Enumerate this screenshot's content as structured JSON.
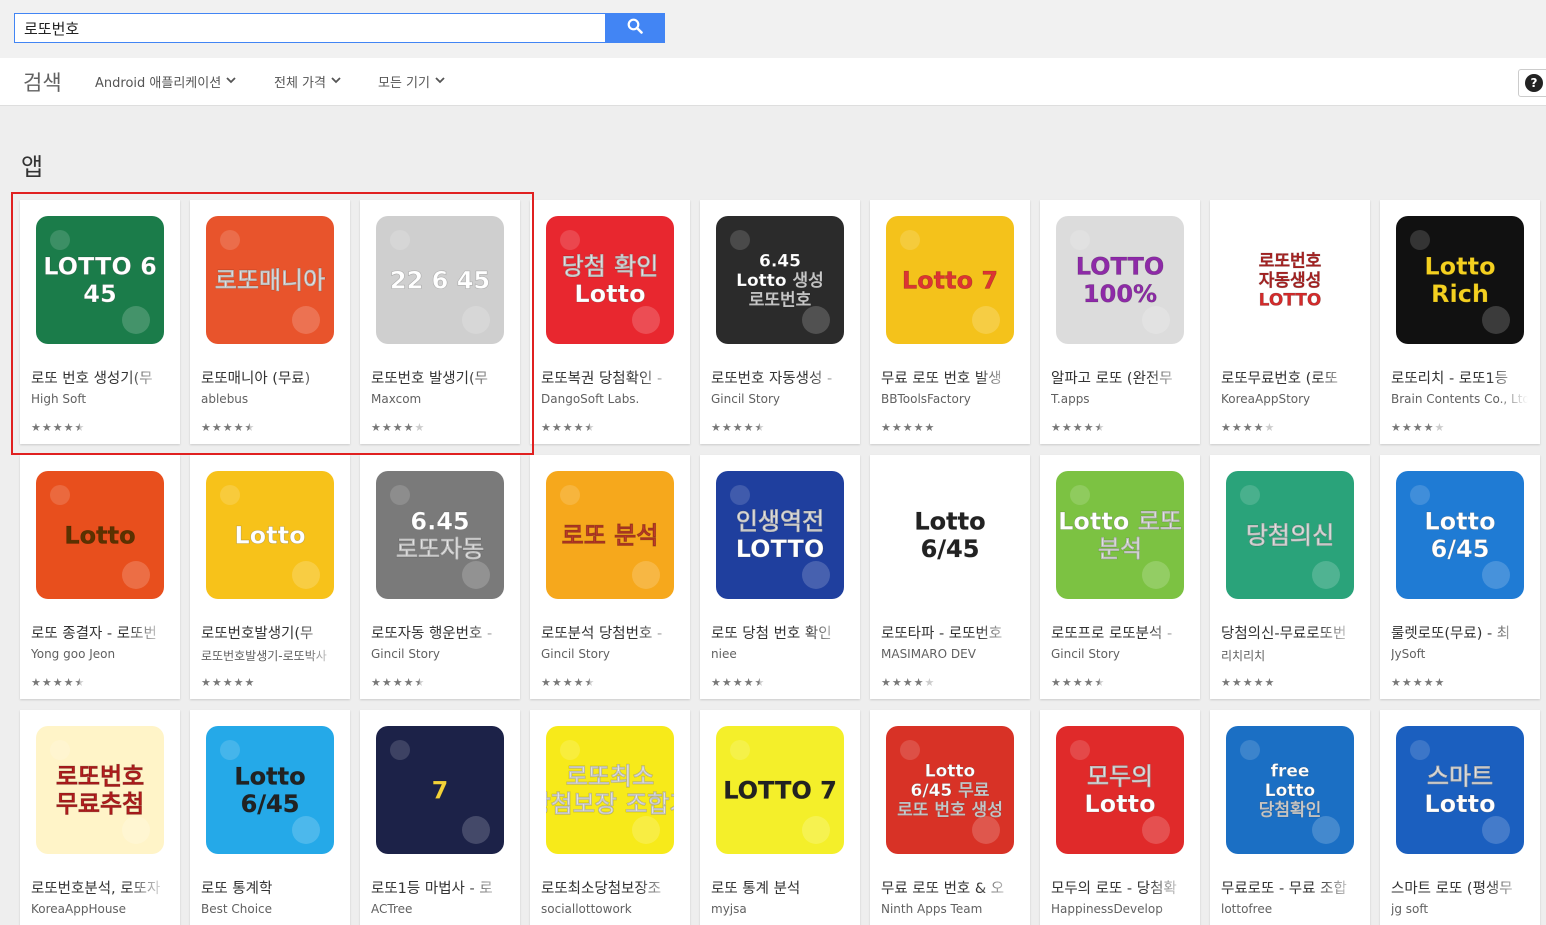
{
  "search": {
    "value": "로또번호"
  },
  "filters": {
    "title": "검색",
    "category": "Android 애플리케이션",
    "price": "전체 가격",
    "device": "모든 기기",
    "help": "?"
  },
  "section_title": "앱",
  "apps": [
    {
      "title": "로또 번호 생성기(무",
      "dev": "High Soft",
      "rating": 4.5,
      "icon": {
        "label": "LOTTO 6 45",
        "bg": "#1b7c4a",
        "fg": "#ffffff"
      }
    },
    {
      "title": "로또매니아 (무료)",
      "dev": "ablebus",
      "rating": 4.5,
      "icon": {
        "label": "로또매니아",
        "bg": "#e8542c",
        "fg": "#ffffff"
      }
    },
    {
      "title": "로또번호 발생기(무",
      "dev": "Maxcom",
      "rating": 4,
      "icon": {
        "label": "22 6 45",
        "bg": "#cfcfcf",
        "fg": "#ffffff"
      }
    },
    {
      "title": "로또복권 당첨확인 -",
      "dev": "DangoSoft Labs.",
      "rating": 4.5,
      "icon": {
        "label": "당첨 확인 Lotto",
        "bg": "#e8272f",
        "fg": "#ffffff"
      }
    },
    {
      "title": "로또번호 자동생성 -",
      "dev": "Gincil Story",
      "rating": 4.5,
      "icon": {
        "label": "6.45 Lotto 생성 로또번호",
        "bg": "#2b2b2b",
        "fg": "#ffffff"
      }
    },
    {
      "title": "무료 로또 번호 발생",
      "dev": "BBToolsFactory",
      "rating": 5,
      "icon": {
        "label": "Lotto 7",
        "bg": "#f4c21b",
        "fg": "#d33"
      }
    },
    {
      "title": "알파고 로또 (완전무",
      "dev": "T.apps",
      "rating": 4.5,
      "icon": {
        "label": "LOTTO 100%",
        "bg": "#dcdcdc",
        "fg": "#8e2aa8"
      }
    },
    {
      "title": "로또무료번호 (로또",
      "dev": "KoreaAppStory",
      "rating": 4,
      "icon": {
        "label": "로또번호 자동생성 LOTTO",
        "bg": "#ffffff",
        "fg": "#d42b2b"
      }
    },
    {
      "title": "로또리치 - 로또1등",
      "dev": "Brain Contents Co., Ltd",
      "rating": 4,
      "icon": {
        "label": "Lotto Rich",
        "bg": "#111111",
        "fg": "#f4d020"
      }
    },
    {
      "title": "로또 종결자 - 로또번",
      "dev": "Yong goo Jeon",
      "rating": 4.5,
      "icon": {
        "label": "Lotto",
        "bg": "#e84f1d",
        "fg": "#5a3200"
      }
    },
    {
      "title": "로또번호발생기(무",
      "dev": "로또번호발생기-로또박사",
      "rating": 5,
      "icon": {
        "label": "Lotto",
        "bg": "#f7c21a",
        "fg": "#ffffff"
      }
    },
    {
      "title": "로또자동 행운번호 -",
      "dev": "Gincil Story",
      "rating": 4.5,
      "icon": {
        "label": "6.45 로또자동",
        "bg": "#7a7a7a",
        "fg": "#ffffff"
      }
    },
    {
      "title": "로또분석 당첨번호 -",
      "dev": "Gincil Story",
      "rating": 4.5,
      "icon": {
        "label": "로또 분석",
        "bg": "#f6a81c",
        "fg": "#d8432c"
      }
    },
    {
      "title": "로또 당첨 번호 확인",
      "dev": "niee",
      "rating": 4.5,
      "icon": {
        "label": "인생역전 LOTTO",
        "bg": "#1f3f9e",
        "fg": "#ffffff"
      }
    },
    {
      "title": "로또타파 - 로또번호",
      "dev": "MASIMARO DEV",
      "rating": 4,
      "icon": {
        "label": "Lotto 6/45",
        "bg": "#ffffff",
        "fg": "#222222"
      }
    },
    {
      "title": "로또프로 로또분석 -",
      "dev": "Gincil Story",
      "rating": 4.5,
      "icon": {
        "label": "Lotto 로또 분석",
        "bg": "#7cc242",
        "fg": "#ffffff"
      }
    },
    {
      "title": "당첨의신-무료로또번",
      "dev": "리치리치",
      "rating": 5,
      "icon": {
        "label": "당첨의신",
        "bg": "#2aa37a",
        "fg": "#ffffff"
      }
    },
    {
      "title": "룰렛로또(무료) - 최",
      "dev": "JySoft",
      "rating": 5,
      "icon": {
        "label": "Lotto 6/45",
        "bg": "#1f7bd4",
        "fg": "#ffffff"
      }
    },
    {
      "title": "로또번호분석, 로또자",
      "dev": "KoreaAppHouse",
      "rating": 0,
      "icon": {
        "label": "로또번호 무료추첨",
        "bg": "#fff4c8",
        "fg": "#d32222"
      }
    },
    {
      "title": "로또 통계학",
      "dev": "Best Choice",
      "rating": 0,
      "icon": {
        "label": "Lotto 6/45",
        "bg": "#25a9e8",
        "fg": "#222222"
      }
    },
    {
      "title": "로또1등 마법사 - 로",
      "dev": "ACTree",
      "rating": 0,
      "icon": {
        "label": "7",
        "bg": "#1c2248",
        "fg": "#f3d23a"
      }
    },
    {
      "title": "로또최소당첨보장조",
      "dev": "sociallottowork",
      "rating": 0,
      "icon": {
        "label": "로또최소 당첨보장 조합기",
        "bg": "#f7ea1a",
        "fg": "#ffffff"
      }
    },
    {
      "title": "로또 통계 분석",
      "dev": "myjsa",
      "rating": 0,
      "icon": {
        "label": "LOTTO 7",
        "bg": "#f4ef2a",
        "fg": "#222222"
      }
    },
    {
      "title": "무료 로또 번호 & 오",
      "dev": "Ninth Apps Team",
      "rating": 0,
      "icon": {
        "label": "Lotto 6/45 무료 로또 번호 생성",
        "bg": "#d83226",
        "fg": "#ffffff"
      }
    },
    {
      "title": "모두의 로또 - 당첨확",
      "dev": "HappinessDevelop",
      "rating": 0,
      "icon": {
        "label": "모두의 Lotto",
        "bg": "#e02a2a",
        "fg": "#ffffff"
      }
    },
    {
      "title": "무료로또 - 무료 조합",
      "dev": "lottofree",
      "rating": 0,
      "icon": {
        "label": "free Lotto 당첨확인",
        "bg": "#1b6fc4",
        "fg": "#ffffff"
      }
    },
    {
      "title": "스마트 로또 (평생무",
      "dev": "jg soft",
      "rating": 0,
      "icon": {
        "label": "스마트 Lotto",
        "bg": "#1b5fbf",
        "fg": "#ffffff"
      }
    }
  ]
}
